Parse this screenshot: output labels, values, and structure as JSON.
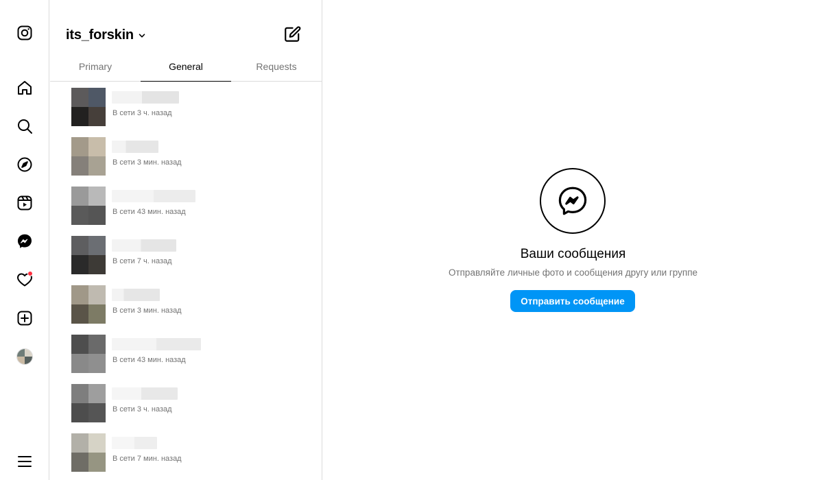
{
  "sidebar": {
    "items": [
      {
        "name": "instagram-logo-icon"
      },
      {
        "name": "home-icon"
      },
      {
        "name": "search-icon"
      },
      {
        "name": "explore-icon"
      },
      {
        "name": "reels-icon"
      },
      {
        "name": "messenger-icon"
      },
      {
        "name": "notifications-heart-icon",
        "badge": true
      },
      {
        "name": "create-plus-icon"
      },
      {
        "name": "profile-avatar"
      },
      {
        "name": "menu-icon"
      }
    ]
  },
  "inbox": {
    "account": "its_forskin",
    "tabs": [
      {
        "label": "Primary",
        "active": false
      },
      {
        "label": "General",
        "active": true
      },
      {
        "label": "Requests",
        "active": false
      }
    ],
    "threads": [
      {
        "status": "В сети 3 ч. назад"
      },
      {
        "status": "В сети 3 мин. назад"
      },
      {
        "status": "В сети 43 мин. назад"
      },
      {
        "status": "В сети 7 ч. назад"
      },
      {
        "status": "В сети 3 мин. назад"
      },
      {
        "status": "В сети 43 мин. назад"
      },
      {
        "status": "В сети 3 ч. назад"
      },
      {
        "status": "В сети 7 мин. назад"
      }
    ]
  },
  "empty_state": {
    "title": "Ваши сообщения",
    "subtitle": "Отправляйте личные фото и сообщения другу или группе",
    "button": "Отправить сообщение"
  },
  "colors": {
    "accent": "#0095f6",
    "border": "#dbdbdb",
    "muted_text": "#737373",
    "notification": "#ff3040"
  }
}
